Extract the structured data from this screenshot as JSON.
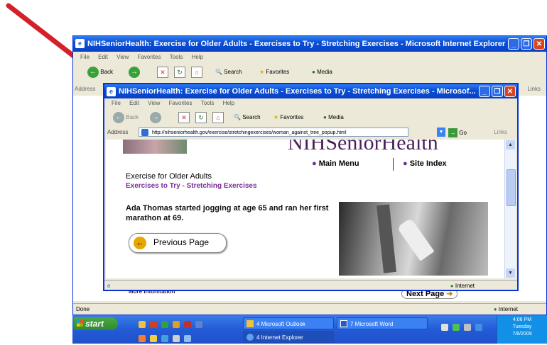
{
  "colors": {
    "arrow": "#d4202a",
    "title_bar": "#0a4fd6",
    "taskbar": "#235bd6",
    "start": "#3d9b37"
  },
  "back_window": {
    "title": "NIHSeniorHealth: Exercise for Older Adults - Exercises to Try - Stretching Exercises - Microsoft Internet Explorer",
    "menu": [
      "File",
      "Edit",
      "View",
      "Favorites",
      "Tools",
      "Help"
    ],
    "toolbar": {
      "back": "Back",
      "search": "Search",
      "favorites": "Favorites",
      "media": "Media"
    },
    "address_label": "Address",
    "links_label": "Links",
    "status_left": "Done",
    "status_right": "Internet",
    "below_content": {
      "more_info": "More Information",
      "next_page": "Next Page"
    }
  },
  "front_window": {
    "title": "NIHSeniorHealth: Exercise for Older Adults - Exercises to Try - Stretching Exercises - Microsof...",
    "menu": [
      "File",
      "Edit",
      "View",
      "Favorites",
      "Tools",
      "Help"
    ],
    "toolbar": {
      "back": "Back",
      "search": "Search",
      "favorites": "Favorites",
      "media": "Media"
    },
    "address_label": "Address",
    "address_url": "http://nihseniorhealth.gov/exercise/stretchingexercises/woman_against_tree_popup.html",
    "go_label": "Go",
    "links_label": "Links",
    "status_right": "Internet"
  },
  "page": {
    "banner_text": "NIHSeniorHealth",
    "nav": {
      "main_menu": "Main Menu",
      "site_index": "Site Index"
    },
    "heading": "Exercise for Older Adults",
    "subheading": "Exercises to Try - Stretching Exercises",
    "caption": "Ada Thomas started jogging at age 65 and ran her first marathon at 69.",
    "previous_button": "Previous Page"
  },
  "taskbar": {
    "start_label": "start",
    "tasks": [
      "4 Microsoft Outlook",
      "7 Microsoft Word",
      "4 Internet Explorer"
    ],
    "clock_time": "4:06 PM",
    "clock_day": "Tuesday",
    "clock_date": "7/6/2009"
  }
}
